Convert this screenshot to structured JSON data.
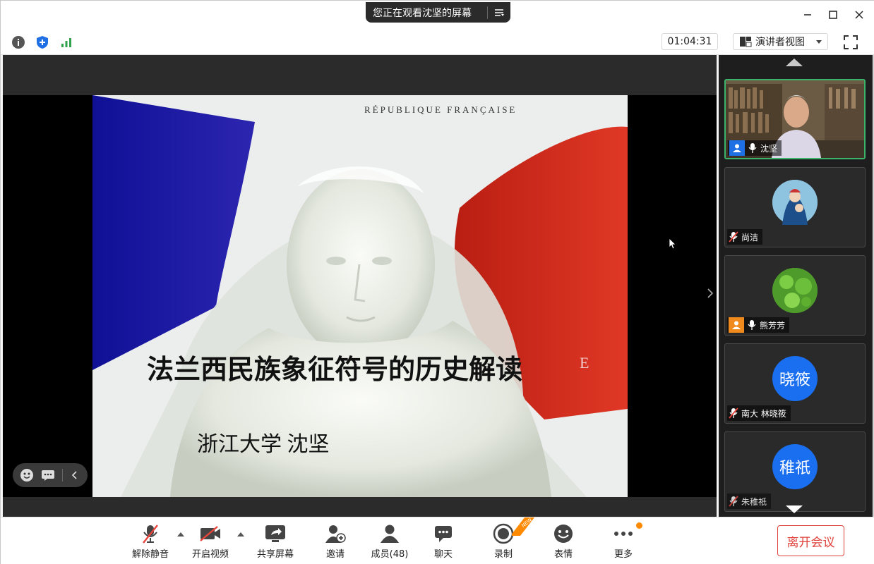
{
  "titlebar": {
    "share_notice": "您正在观看沈坚的屏幕",
    "menu_icon": "list-menu-icon",
    "controls": [
      "minimize-icon",
      "maximize-icon",
      "close-icon"
    ]
  },
  "toolbar": {
    "icons": [
      "info-icon",
      "shield-plus-icon",
      "signal-bars-icon"
    ],
    "timer": "01:04:31",
    "view_mode": "演讲者视图",
    "fullscreen_icon": "fullscreen-icon"
  },
  "slide": {
    "header": "RÉPUBLIQUE FRANÇAISE",
    "title": "法兰西民族象征符号的历史解读",
    "author": "浙江大学  沈坚",
    "ghost_letter": "E",
    "colors": {
      "blue": "#16139a",
      "red": "#c8251a",
      "white": "#f2f2f2"
    }
  },
  "participants": [
    {
      "name": "沈坚",
      "avatar_text": "",
      "avatar_color": "#6b5a44",
      "mic": "on",
      "role": "host",
      "active": true
    },
    {
      "name": "尚洁",
      "avatar_text": "",
      "avatar_color": "#7fb6d8",
      "mic": "muted",
      "role": "",
      "active": false
    },
    {
      "name": "熊芳芳",
      "avatar_text": "",
      "avatar_color": "#5aa02c",
      "mic": "on",
      "role": "cohost",
      "active": false
    },
    {
      "name": "南大 林晓筱",
      "avatar_text": "晓筱",
      "avatar_color": "#1a6ff0",
      "mic": "muted",
      "role": "",
      "active": false
    },
    {
      "name": "朱稚祇",
      "avatar_text": "稚祇",
      "avatar_color": "#1a6ff0",
      "mic": "muted",
      "role": "",
      "active": false
    }
  ],
  "bottombar": {
    "unmute": "解除静音",
    "start_video": "开启视频",
    "share_screen": "共享屏幕",
    "invite": "邀请",
    "members": "成员(48)",
    "chat": "聊天",
    "record": "录制",
    "record_badge": "NEW",
    "reactions": "表情",
    "more": "更多",
    "leave": "离开会议"
  }
}
